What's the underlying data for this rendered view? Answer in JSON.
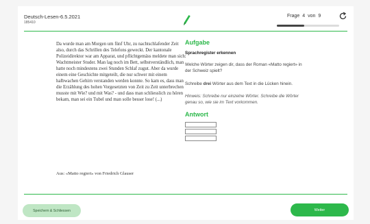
{
  "header": {
    "exam_title": "Deutsch-Lesen-6.5.2021",
    "exam_id": "185410",
    "pencil_icon": "pencil-icon",
    "reload_icon": "reload-icon",
    "question_word": "Frage",
    "question_current": "4",
    "question_of": "von",
    "question_total": "9",
    "progress_fraction": 0.44
  },
  "passage": {
    "text": "Da wurde man am Morgen um fünf Uhr, zu nachtschlafender Zeit also, durch das Schrillen des Telefons geweckt. Der kantonale Polizeidirektor war am Apparat, und pflichtgemäss meldete man sich: Wachtmeister Studer. Man lag noch im Bett, selbstverständlich, man hatte noch mindestens zwei Stunden Schlaf zugut. Aber da wurde einem eine Geschichte mitgeteilt, die nur schwer mit einem halbwachen Gehirn verstanden werden konnte. So kam es, dass man die Erzählung des hohen Vorgesetzten von Zeit zu Zeit unterbrechen musste mit Wie? und mit Was? - und dass man schliesslich zu hören bekam, man sei ein Tubel und man solle besser lose! (...)",
    "source": "Aus: «Matto regiert» von Friedrich Glauser"
  },
  "task": {
    "heading": "Aufgabe",
    "subheading": "Sprachregister erkennen",
    "question": "Welche Wörter zeigen dir, dass der Roman «Matto regiert» in der Schweiz spielt?",
    "instruction_pre": "Schreibe ",
    "instruction_bold": "drei",
    "instruction_post": " Wörter aus dem Text in die Lücken hinein.",
    "hint": "Hinweis: Schreibe nur einzelne Wörter. Schreibe die Wörter genau so, wie sie im Text vorkommen.",
    "answer_heading": "Antwort",
    "answers": [
      "",
      "",
      ""
    ]
  },
  "footer": {
    "save_label": "Speichern & Schliessen",
    "next_label": "Weiter"
  },
  "colors": {
    "accent": "#2db84b",
    "accent_light": "#bfe6c4",
    "progress_fill": "#444444",
    "page_bg": "#f5f5f5"
  }
}
